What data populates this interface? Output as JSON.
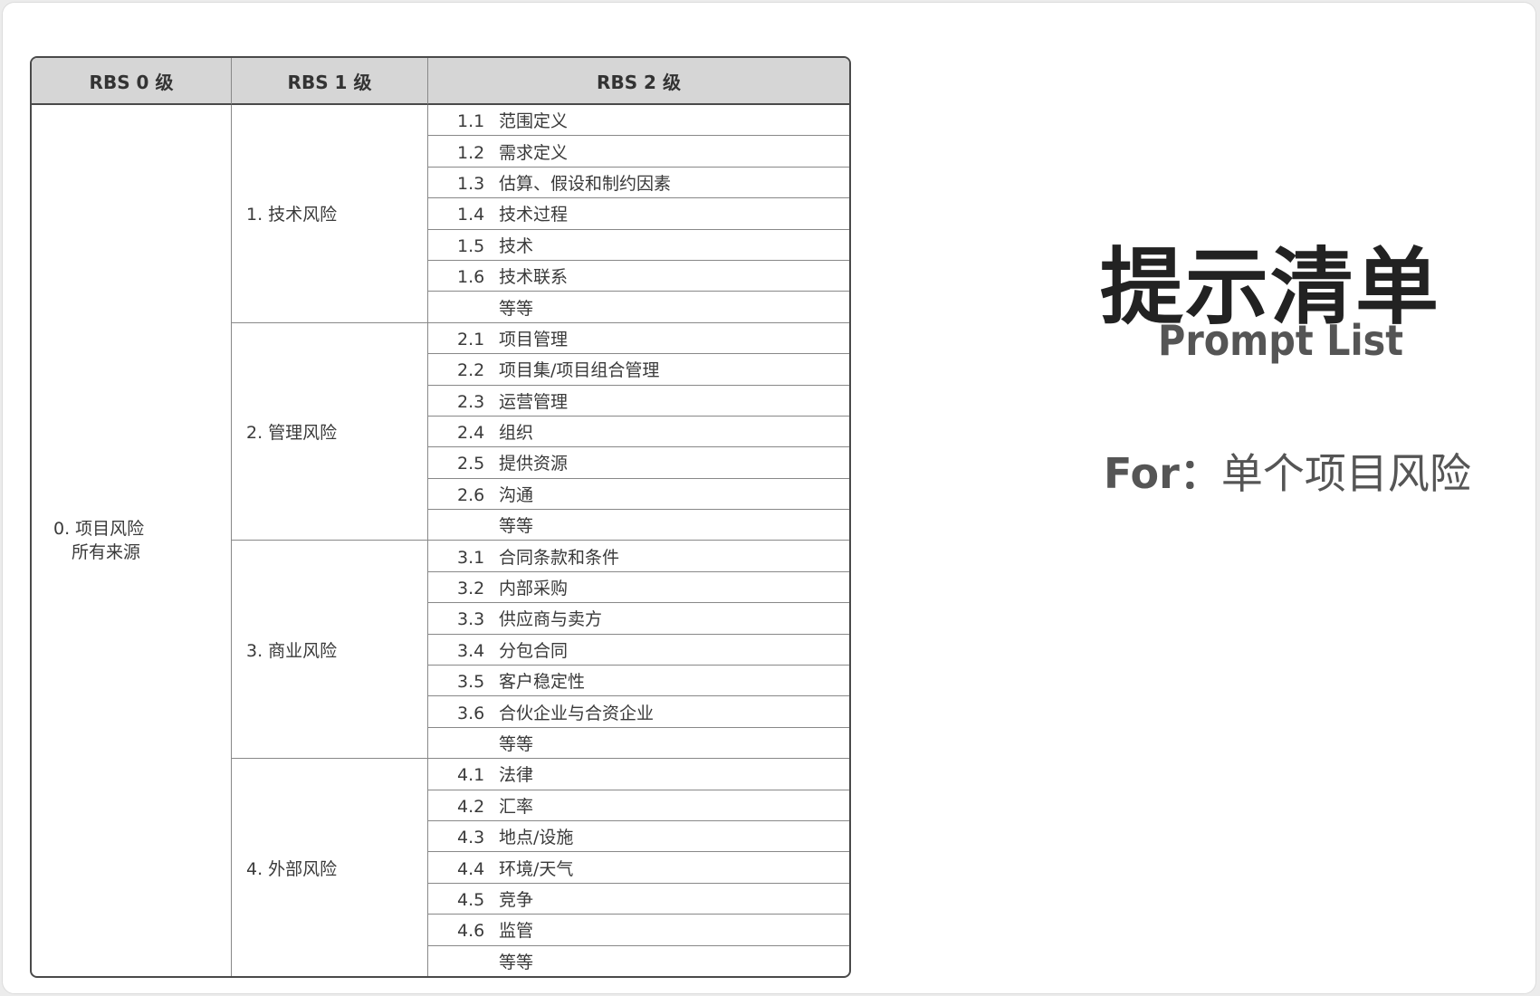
{
  "table": {
    "headers": [
      "RBS 0 级",
      "RBS 1 级",
      "RBS 2 级"
    ],
    "level0_line1": "0. 项目风险",
    "level0_line2": "所有来源",
    "groups": [
      {
        "label": "1. 技术风险",
        "items": [
          {
            "num": "1.1",
            "text": "范围定义"
          },
          {
            "num": "1.2",
            "text": "需求定义"
          },
          {
            "num": "1.3",
            "text": "估算、假设和制约因素"
          },
          {
            "num": "1.4",
            "text": "技术过程"
          },
          {
            "num": "1.5",
            "text": "技术"
          },
          {
            "num": "1.6",
            "text": "技术联系"
          },
          {
            "num": "",
            "text": "等等"
          }
        ]
      },
      {
        "label": "2. 管理风险",
        "items": [
          {
            "num": "2.1",
            "text": "项目管理"
          },
          {
            "num": "2.2",
            "text": "项目集/项目组合管理"
          },
          {
            "num": "2.3",
            "text": "运营管理"
          },
          {
            "num": "2.4",
            "text": "组织"
          },
          {
            "num": "2.5",
            "text": "提供资源"
          },
          {
            "num": "2.6",
            "text": "沟通"
          },
          {
            "num": "",
            "text": "等等"
          }
        ]
      },
      {
        "label": "3. 商业风险",
        "items": [
          {
            "num": "3.1",
            "text": "合同条款和条件"
          },
          {
            "num": "3.2",
            "text": "内部采购"
          },
          {
            "num": "3.3",
            "text": "供应商与卖方"
          },
          {
            "num": "3.4",
            "text": "分包合同"
          },
          {
            "num": "3.5",
            "text": "客户稳定性"
          },
          {
            "num": "3.6",
            "text": "合伙企业与合资企业"
          },
          {
            "num": "",
            "text": "等等"
          }
        ]
      },
      {
        "label": "4. 外部风险",
        "items": [
          {
            "num": "4.1",
            "text": "法律"
          },
          {
            "num": "4.2",
            "text": "汇率"
          },
          {
            "num": "4.3",
            "text": "地点/设施"
          },
          {
            "num": "4.4",
            "text": "环境/天气"
          },
          {
            "num": "4.5",
            "text": "竞争"
          },
          {
            "num": "4.6",
            "text": "监管"
          },
          {
            "num": "",
            "text": "等等"
          }
        ]
      }
    ]
  },
  "side": {
    "title": "提示清单",
    "subtitle": "Prompt List",
    "for_label": "For：",
    "for_value": "单个项目风险"
  }
}
